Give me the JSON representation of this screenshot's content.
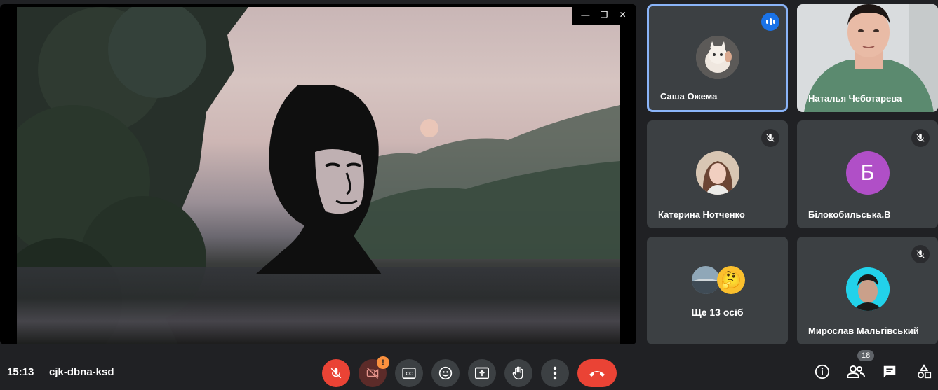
{
  "presentation": {
    "window_controls": [
      "minimize-icon",
      "restore-icon",
      "close-icon"
    ]
  },
  "participants": [
    {
      "name": "Саша Ожема",
      "speaking": true,
      "avatar": "kitten-photo"
    },
    {
      "name": "Наталья Чеботарева",
      "video": true
    },
    {
      "name": "Катерина Нотченко",
      "muted": true,
      "avatar": "photo"
    },
    {
      "name": "Білокобильська.В",
      "muted": true,
      "avatar_letter": "Б",
      "avatar_color": "#b04fc7"
    },
    {
      "name": "Ще 13 осіб"
    },
    {
      "name": "Мирослав Мальгівський",
      "muted": true,
      "avatar": "photo"
    }
  ],
  "meeting": {
    "time": "15:13",
    "code": "cjk-dbna-ksd",
    "participants_count": "18",
    "camera_warning": "!"
  },
  "colors": {
    "accent": "#8ab4f8",
    "danger": "#ea4335",
    "tile": "#3c4043",
    "background": "#202124"
  },
  "icons": {
    "mic": "mic-off-icon",
    "camera": "camera-off-icon",
    "captions": "captions-icon",
    "emoji": "emoji-icon",
    "present": "present-icon",
    "hand": "raise-hand-icon",
    "more": "more-options-icon",
    "end": "end-call-icon",
    "info": "info-icon",
    "people": "people-icon",
    "chat": "chat-icon",
    "activities": "activities-icon"
  }
}
